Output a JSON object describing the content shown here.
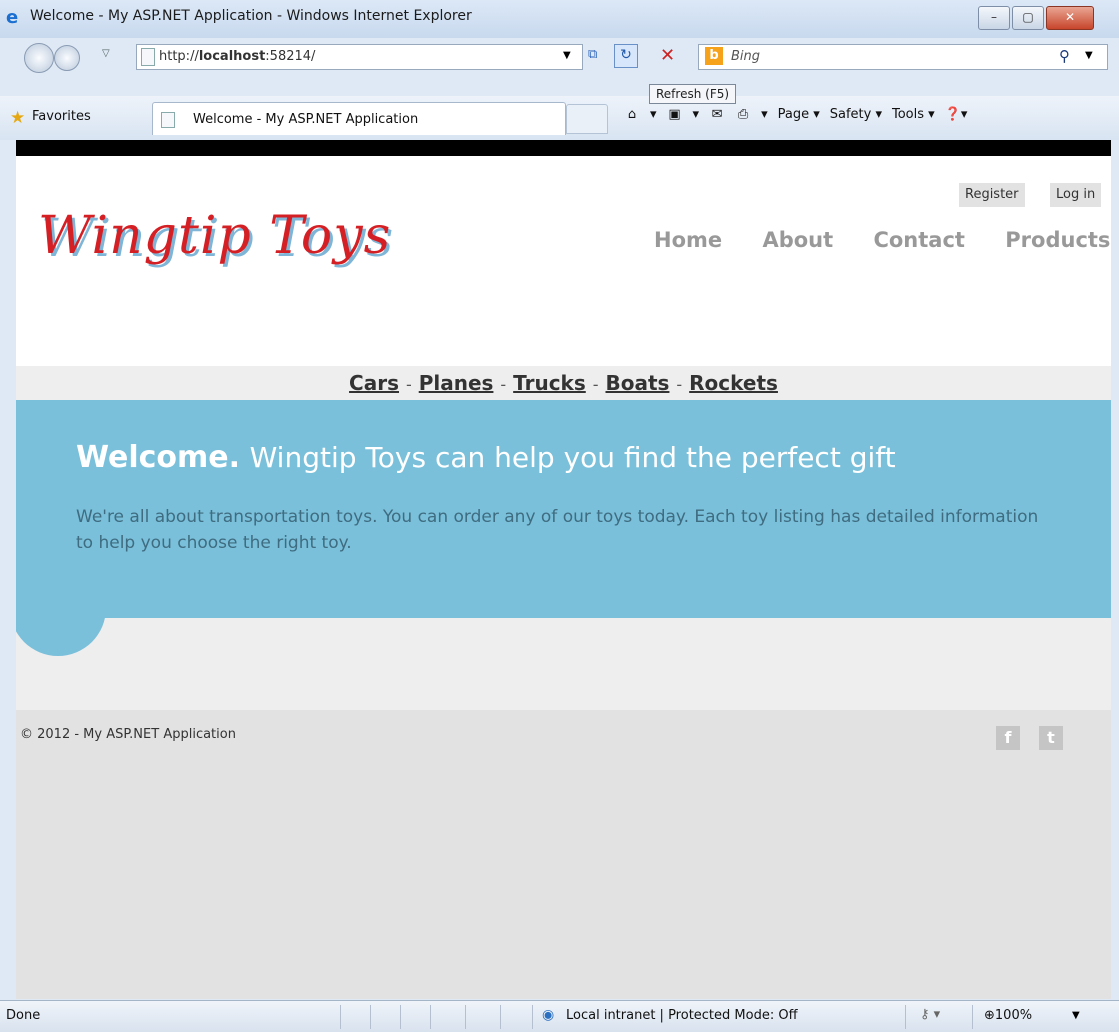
{
  "window": {
    "title": "Welcome - My ASP.NET Application - Windows Internet Explorer",
    "minimize": "–",
    "maximize": "▢",
    "close": "✕"
  },
  "address": {
    "url_prefix": "http://",
    "url_host": "localhost",
    "url_rest": ":58214/",
    "refresh_tooltip": "Refresh (F5)"
  },
  "search": {
    "placeholder": "Bing",
    "logo": "b"
  },
  "favorites": {
    "label": "Favorites"
  },
  "tab": {
    "title": "Welcome - My ASP.NET Application"
  },
  "commands": {
    "page": "Page ▾",
    "safety": "Safety ▾",
    "tools": "Tools ▾",
    "help": "❓▾"
  },
  "site": {
    "logo": "Wingtip Toys",
    "register": "Register",
    "login": "Log in",
    "nav": [
      "Home",
      "About",
      "Contact",
      "Products"
    ],
    "categories": [
      "Cars",
      "Planes",
      "Trucks",
      "Boats",
      "Rockets"
    ],
    "separator": "-",
    "hero_strong": "Welcome.",
    "hero_lead": "Wingtip Toys can help you find the perfect gift",
    "hero_text": "We're all about transportation toys. You can order any of our toys today. Each toy listing has detailed information to help you choose the right toy.",
    "footer": "© 2012 - My ASP.NET Application",
    "facebook": "f",
    "twitter": "t"
  },
  "status": {
    "text": "Done",
    "zone": "Local intranet | Protected Mode: Off",
    "zoom": "100%"
  },
  "colors": {
    "hero_bg": "#7ac0da",
    "logo_red": "#d42025",
    "nav_gray": "#999999"
  }
}
